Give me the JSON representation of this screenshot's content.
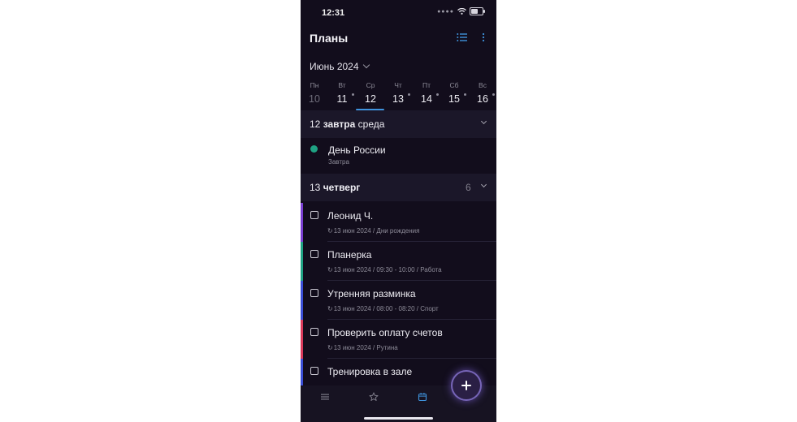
{
  "status_bar": {
    "time": "12:31",
    "signal_icon": "cellular-signal-icon",
    "wifi_icon": "wifi-icon",
    "battery_icon": "battery-charging-icon"
  },
  "header": {
    "title": "Планы",
    "list_icon": "list-view-icon",
    "more_icon": "more-vertical-icon"
  },
  "calendar": {
    "month_label": "Июнь 2024",
    "days": [
      {
        "name": "Пн",
        "num": "10",
        "past": true,
        "dot": false
      },
      {
        "name": "Вт",
        "num": "11",
        "past": false,
        "dot": true
      },
      {
        "name": "Ср",
        "num": "12",
        "past": false,
        "dot": false,
        "selected": true
      },
      {
        "name": "Чт",
        "num": "13",
        "past": false,
        "dot": true
      },
      {
        "name": "Пт",
        "num": "14",
        "past": false,
        "dot": true
      },
      {
        "name": "Сб",
        "num": "15",
        "past": false,
        "dot": true
      },
      {
        "name": "Вс",
        "num": "16",
        "past": false,
        "dot": true
      }
    ]
  },
  "sections": {
    "s12": {
      "day": "12",
      "label": "завтра",
      "weekday": "среда"
    },
    "s13": {
      "day": "13",
      "label": "четверг",
      "count": "6"
    }
  },
  "holiday": {
    "title": "День России",
    "subtitle": "Завтра",
    "color": "#1fa283"
  },
  "tasks": [
    {
      "title": "Леонид Ч.",
      "subtitle": "13 июн 2024 / Дни рождения",
      "color": "#7a3fd1"
    },
    {
      "title": "Планерка",
      "subtitle": "13 июн 2024 / 09:30 - 10:00 / Работа",
      "color": "#1fa283"
    },
    {
      "title": "Утренняя разминка",
      "subtitle": "13 июн 2024 / 08:00 - 08:20 / Спорт",
      "color": "#3b4fd6"
    },
    {
      "title": "Проверить оплату счетов",
      "subtitle": "13 июн 2024 / Рутина",
      "color": "#d9395b"
    },
    {
      "title": "Тренировка в зале",
      "subtitle": "",
      "color": "#3b4fd6"
    }
  ],
  "bottom_nav": {
    "items": [
      "menu-icon",
      "star-icon",
      "calendar-icon"
    ],
    "active": "calendar-icon"
  },
  "fab": {
    "icon": "plus-icon"
  },
  "colors": {
    "background": "#120d1c",
    "section_bg": "#1b1729",
    "accent": "#3f93dd"
  }
}
